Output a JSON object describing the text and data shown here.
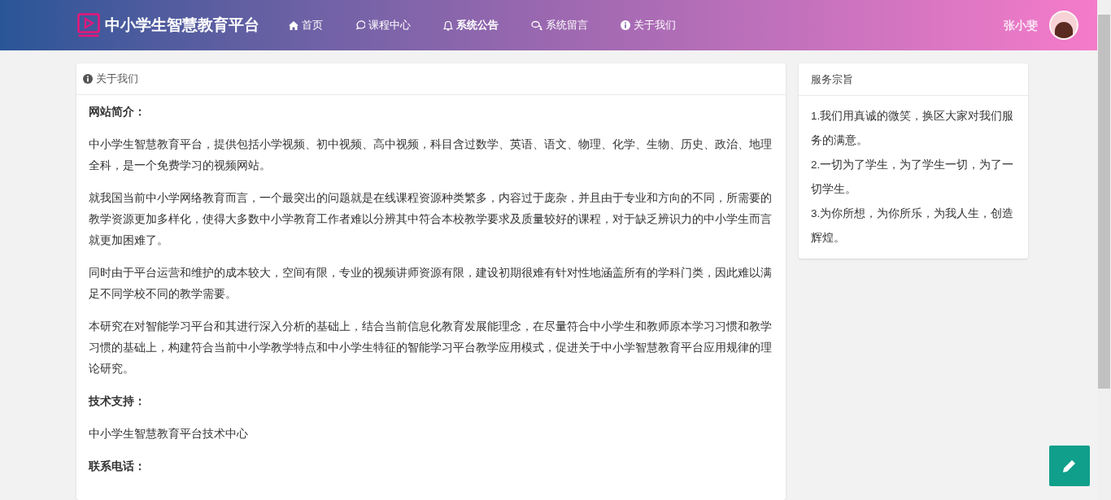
{
  "brand": {
    "title": "中小学生智慧教育平台"
  },
  "nav": [
    {
      "label": "首页",
      "selected": false
    },
    {
      "label": "课程中心",
      "selected": false
    },
    {
      "label": "系统公告",
      "selected": true
    },
    {
      "label": "系统留言",
      "selected": false
    },
    {
      "label": "关于我们",
      "selected": false
    }
  ],
  "user": {
    "name": "张小斐"
  },
  "about": {
    "title": "关于我们",
    "blocks": [
      {
        "kind": "heading",
        "text": "网站简介："
      },
      {
        "kind": "paragraph",
        "text": "中小学生智慧教育平台，提供包括小学视频、初中视频、高中视频，科目含过数学、英语、语文、物理、化学、生物、历史、政治、地理全科，是一个免费学习的视频网站。"
      },
      {
        "kind": "paragraph",
        "text": "就我国当前中小学网络教育而言，一个最突出的问题就是在线课程资源种类繁多，内容过于庞杂，并且由于专业和方向的不同，所需要的教学资源更加多样化，使得大多数中小学教育工作者难以分辨其中符合本校教学要求及质量较好的课程，对于缺乏辨识力的中小学生而言就更加困难了。"
      },
      {
        "kind": "paragraph",
        "text": "同时由于平台运营和维护的成本较大，空间有限，专业的视频讲师资源有限，建设初期很难有针对性地涵盖所有的学科门类，因此难以满足不同学校不同的教学需要。"
      },
      {
        "kind": "paragraph",
        "text": "本研究在对智能学习平台和其进行深入分析的基础上，结合当前信息化教育发展能理念，在尽量符合中小学生和教师原本学习习惯和教学习惯的基础上，构建符合当前中小学教学特点和中小学生特征的智能学习平台教学应用模式，促进关于中小学智慧教育平台应用规律的理论研究。"
      },
      {
        "kind": "heading",
        "text": "技术支持："
      },
      {
        "kind": "paragraph",
        "text": "中小学生智慧教育平台技术中心"
      },
      {
        "kind": "heading",
        "text": "联系电话："
      }
    ]
  },
  "service": {
    "title": "服务宗旨",
    "items": [
      "1.我们用真诚的微笑，换区大家对我们服务的满意。",
      "2.一切为了学生，为了学生一切，为了一切学生。",
      "3.为你所想，为你所乐，为我人生，创造辉煌。"
    ]
  }
}
